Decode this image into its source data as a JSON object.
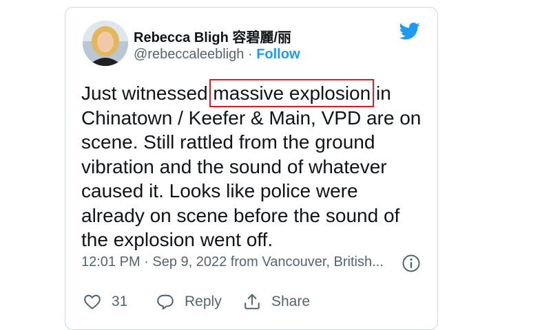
{
  "tweet": {
    "author": {
      "display_name": "Rebecca Bligh 容碧麗/丽",
      "handle": "@rebeccaleebligh",
      "separator": " · ",
      "follow_label": "Follow"
    },
    "text_before": "Just witnessed ",
    "text_highlight": "massive explosion",
    "text_after": " in Chinatown / Keefer & Main, VPD are on scene. Still rattled from the ground vibration and the sound of whatever caused it. Looks like police were already on scene before the sound of the explosion went off.",
    "timestamp": "12:01 PM · Sep 9, 2022 from Vancouver, British...",
    "actions": {
      "like_count": "31",
      "reply_label": "Reply",
      "share_label": "Share"
    }
  },
  "colors": {
    "accent": "#1d9bf0",
    "highlight_box": "#e0191f",
    "text": "#0f1419",
    "muted": "#536471"
  },
  "icons": [
    "twitter-bird-icon",
    "info-icon",
    "heart-icon",
    "reply-bubble-icon",
    "share-icon"
  ]
}
